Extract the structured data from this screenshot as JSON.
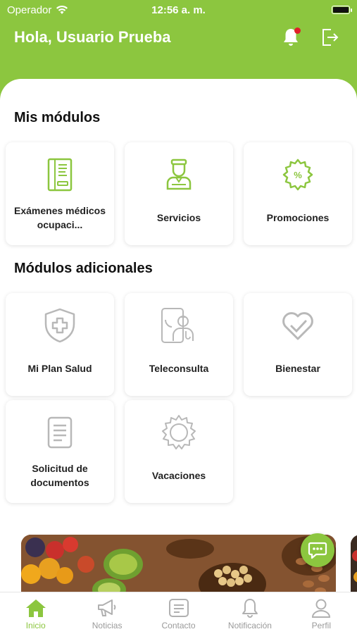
{
  "status_bar": {
    "carrier": "Operador",
    "time": "12:56 a. m."
  },
  "header": {
    "greeting": "Hola, Usuario Prueba"
  },
  "colors": {
    "accent": "#8cc63f",
    "notification_dot": "#e0202a",
    "inactive_icon": "#b8b8b8"
  },
  "sections": {
    "mis_modulos": {
      "title": "Mis módulos",
      "items": [
        {
          "label": "Exámenes médicos ocupaci...",
          "icon": "medical-exam-icon"
        },
        {
          "label": "Servicios",
          "icon": "service-worker-icon"
        },
        {
          "label": "Promociones",
          "icon": "promotion-badge-icon"
        }
      ]
    },
    "adicionales": {
      "title": "Módulos adicionales",
      "items": [
        {
          "label": "Mi Plan Salud",
          "icon": "shield-plus-icon"
        },
        {
          "label": "Teleconsulta",
          "icon": "teleconsult-doctor-icon"
        },
        {
          "label": "Bienestar",
          "icon": "heart-check-icon"
        },
        {
          "label": "Solicitud de documentos",
          "icon": "document-icon"
        },
        {
          "label": "Vacaciones",
          "icon": "sun-icon"
        }
      ]
    }
  },
  "tabbar": {
    "tabs": [
      {
        "label": "Inicio",
        "icon": "home-icon",
        "active": true
      },
      {
        "label": "Noticias",
        "icon": "megaphone-icon",
        "active": false
      },
      {
        "label": "Contacto",
        "icon": "contact-form-icon",
        "active": false
      },
      {
        "label": "Notificación",
        "icon": "bell-icon",
        "active": false
      },
      {
        "label": "Perfil",
        "icon": "user-icon",
        "active": false
      }
    ]
  }
}
